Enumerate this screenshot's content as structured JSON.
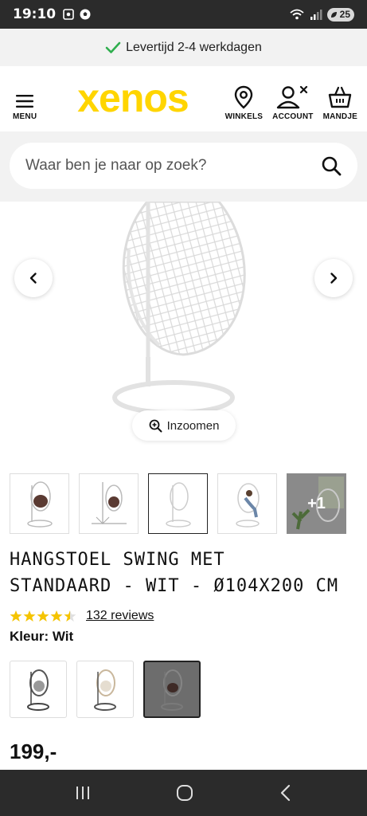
{
  "status_bar": {
    "time": "19:10",
    "battery": "25"
  },
  "delivery": {
    "text": "Levertijd 2-4 werkdagen",
    "check_color": "#2fae4e"
  },
  "header": {
    "menu_label": "MENU",
    "logo_text": "xenos",
    "logo_color": "#ffd500",
    "nav": [
      {
        "label": "WINKELS",
        "icon": "location-pin-icon"
      },
      {
        "label": "ACCOUNT",
        "icon": "account-icon"
      },
      {
        "label": "MANDJE",
        "icon": "basket-icon"
      }
    ]
  },
  "search": {
    "placeholder": "Waar ben je naar op zoek?"
  },
  "gallery": {
    "zoom_label": "Inzoomen",
    "thumbnails": [
      {
        "selected": false
      },
      {
        "selected": false
      },
      {
        "selected": true
      },
      {
        "selected": false
      },
      {
        "selected": false,
        "more_label": "+1"
      }
    ]
  },
  "product": {
    "title_line1": "Hangstoel Swing met",
    "title_line2": "standaard - wit - Ø104x200 cm",
    "rating": 4.5,
    "rating_max": 5,
    "star_color": "#f5c400",
    "reviews_label": "132 reviews",
    "color_label": "Kleur: Wit",
    "price": "199,-"
  }
}
